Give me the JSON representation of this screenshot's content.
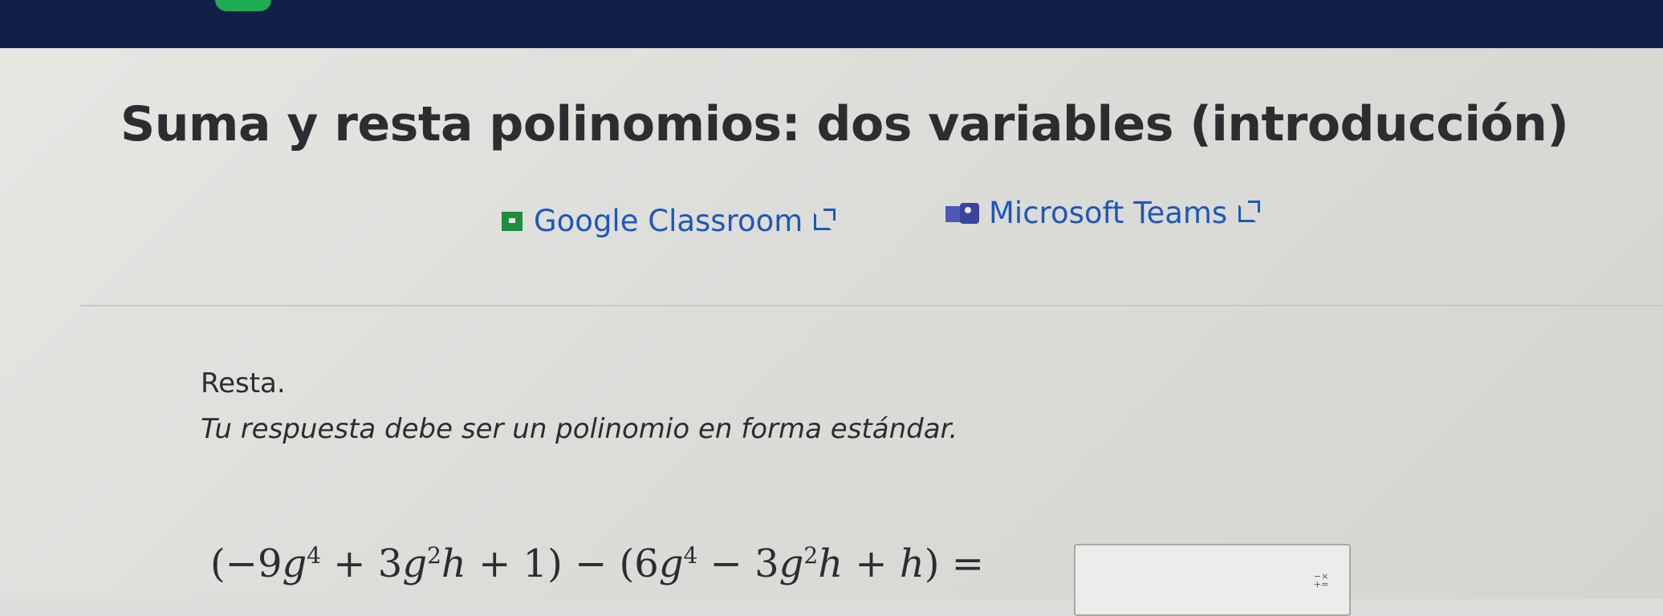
{
  "page": {
    "title": "Suma y resta polinomios: dos variables (introducción)"
  },
  "share": {
    "google_label": "Google Classroom",
    "teams_label": "Microsoft Teams"
  },
  "exercise": {
    "prompt": "Resta.",
    "instruction": "Tu respuesta debe ser un polinomio en forma estándar.",
    "equation": {
      "open1": "(−9",
      "v1": "g",
      "e1": "4",
      "t2": " + 3",
      "v2": "g",
      "e2": "2",
      "v2b": "h",
      "t3": " + 1) − (6",
      "v3": "g",
      "e3": "4",
      "t4": " − 3",
      "v4": "g",
      "e4": "2",
      "v4b": "h",
      "t5": " + ",
      "v5": "h",
      "close": ") ="
    },
    "answer_value": ""
  },
  "icons": {
    "google": "google-classroom-icon",
    "teams": "microsoft-teams-icon",
    "external": "external-link-icon",
    "keypad": "math-keypad-icon"
  }
}
